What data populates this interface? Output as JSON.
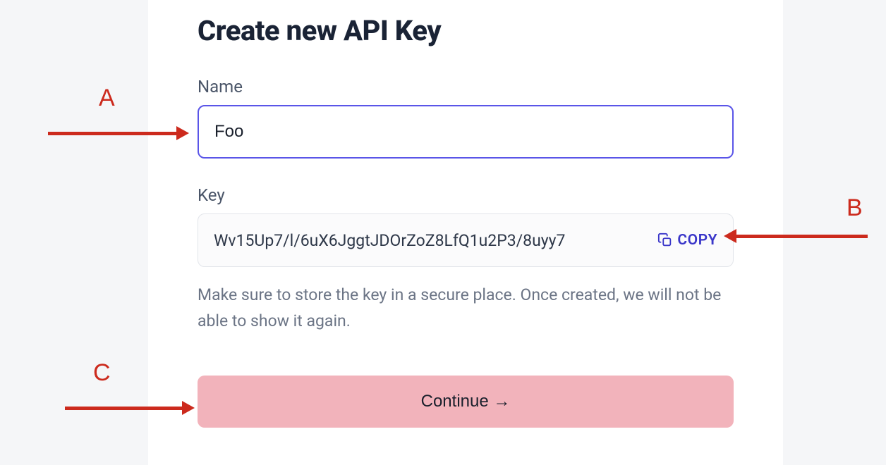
{
  "form": {
    "title": "Create new API Key",
    "name_label": "Name",
    "name_value": "Foo",
    "key_label": "Key",
    "key_value": "Wv15Up7/l/6uX6JggtJDOrZoZ8LfQ1u2P3/8uyy7",
    "copy_label": "COPY",
    "help_text": "Make sure to store the key in a secure place. Once created, we will not be able to show it again.",
    "continue_label": "Continue →"
  },
  "annotations": {
    "a": "A",
    "b": "B",
    "c": "C"
  },
  "colors": {
    "annotation": "#cc2a1d",
    "focus_border": "#5a55e8",
    "copy_link": "#3a36c9",
    "button_bg": "#f2b3bb"
  }
}
